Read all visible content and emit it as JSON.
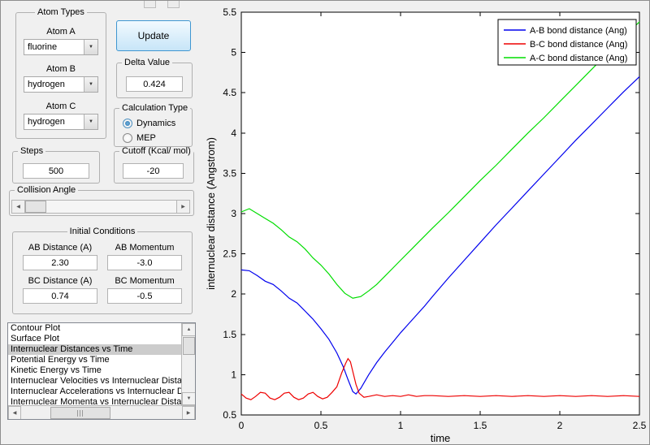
{
  "atom_types": {
    "title": "Atom Types",
    "atom_a_label": "Atom A",
    "atom_a_value": "fluorine",
    "atom_b_label": "Atom B",
    "atom_b_value": "hydrogen",
    "atom_c_label": "Atom C",
    "atom_c_value": "hydrogen"
  },
  "update_button_label": "Update",
  "delta": {
    "title": "Delta Value",
    "value": "0.424"
  },
  "calculation_type": {
    "title": "Calculation Type",
    "options": [
      "Dynamics",
      "MEP"
    ],
    "selected": "Dynamics"
  },
  "steps": {
    "title": "Steps",
    "value": "500"
  },
  "cutoff": {
    "title": "Cutoff (Kcal/ mol)",
    "value": "-20"
  },
  "collision_angle": {
    "title": "Collision Angle"
  },
  "initial_conditions": {
    "title": "Initial Conditions",
    "ab_distance_label": "AB Distance (A)",
    "ab_distance_value": "2.30",
    "ab_momentum_label": "AB Momentum",
    "ab_momentum_value": "-3.0",
    "bc_distance_label": "BC Distance (A)",
    "bc_distance_value": "0.74",
    "bc_momentum_label": "BC Momentum",
    "bc_momentum_value": "-0.5"
  },
  "plot_list": {
    "items": [
      "Contour Plot",
      "Surface Plot",
      "Internuclear Distances vs Time",
      "Potential Energy vs Time",
      "Kinetic Energy vs Time",
      "Internuclear Velocities vs Internuclear Distance",
      "Internuclear Accelerations vs Internuclear Distance",
      "Internuclear Momenta vs Internuclear Distance"
    ],
    "selected_index": 2
  },
  "chart_data": {
    "type": "line",
    "xlabel": "time",
    "ylabel": "internuclear distance (Angstrom)",
    "xlim": [
      0,
      2.5
    ],
    "ylim": [
      0.5,
      5.5
    ],
    "x_tick_values": [
      0,
      0.5,
      1,
      1.5,
      2,
      2.5
    ],
    "x_tick_labels": [
      "0",
      "0.5",
      "1",
      "1.5",
      "2",
      "2.5"
    ],
    "y_tick_values": [
      0.5,
      1,
      1.5,
      2,
      2.5,
      3,
      3.5,
      4,
      4.5,
      5,
      5.5
    ],
    "y_tick_labels": [
      "0.5",
      "1",
      "1.5",
      "2",
      "2.5",
      "3",
      "3.5",
      "4",
      "4.5",
      "5",
      "5.5"
    ],
    "grid": false,
    "legend": {
      "position": "northeast",
      "entries": [
        "A-B bond distance (Ang)",
        "B-C bond distance (Ang)",
        "A-C bond distance (Ang)"
      ]
    },
    "series": [
      {
        "name": "A-B bond distance (Ang)",
        "color": "#0000ee",
        "x": [
          0,
          0.05,
          0.1,
          0.15,
          0.2,
          0.25,
          0.3,
          0.35,
          0.4,
          0.45,
          0.5,
          0.55,
          0.6,
          0.64,
          0.67,
          0.7,
          0.72,
          0.75,
          0.8,
          0.85,
          0.9,
          0.95,
          1.0,
          1.05,
          1.1,
          1.15,
          1.2,
          1.3,
          1.4,
          1.5,
          1.6,
          1.7,
          1.8,
          1.9,
          2.0,
          2.1,
          2.2,
          2.3,
          2.4,
          2.5
        ],
        "y": [
          2.3,
          2.29,
          2.23,
          2.16,
          2.12,
          2.04,
          1.95,
          1.89,
          1.79,
          1.69,
          1.57,
          1.44,
          1.27,
          1.1,
          0.94,
          0.79,
          0.76,
          0.83,
          1.0,
          1.15,
          1.28,
          1.4,
          1.52,
          1.63,
          1.74,
          1.85,
          1.97,
          2.2,
          2.42,
          2.64,
          2.86,
          3.07,
          3.28,
          3.49,
          3.7,
          3.91,
          4.11,
          4.31,
          4.51,
          4.7
        ]
      },
      {
        "name": "B-C bond distance (Ang)",
        "color": "#ee0000",
        "x": [
          0,
          0.03,
          0.06,
          0.09,
          0.12,
          0.15,
          0.18,
          0.21,
          0.24,
          0.27,
          0.3,
          0.33,
          0.36,
          0.39,
          0.42,
          0.45,
          0.48,
          0.51,
          0.54,
          0.57,
          0.6,
          0.63,
          0.655,
          0.67,
          0.685,
          0.7,
          0.72,
          0.74,
          0.77,
          0.8,
          0.85,
          0.9,
          0.95,
          1.0,
          1.05,
          1.1,
          1.15,
          1.2,
          1.3,
          1.4,
          1.5,
          1.6,
          1.7,
          1.8,
          1.9,
          2.0,
          2.1,
          2.2,
          2.3,
          2.4,
          2.5
        ],
        "y": [
          0.76,
          0.71,
          0.69,
          0.73,
          0.78,
          0.77,
          0.71,
          0.69,
          0.72,
          0.77,
          0.78,
          0.72,
          0.69,
          0.71,
          0.76,
          0.78,
          0.73,
          0.7,
          0.72,
          0.78,
          0.85,
          1.02,
          1.14,
          1.2,
          1.16,
          1.04,
          0.88,
          0.77,
          0.72,
          0.73,
          0.75,
          0.73,
          0.74,
          0.73,
          0.75,
          0.73,
          0.74,
          0.74,
          0.73,
          0.74,
          0.73,
          0.74,
          0.73,
          0.74,
          0.73,
          0.74,
          0.73,
          0.74,
          0.73,
          0.74,
          0.73
        ]
      },
      {
        "name": "A-C bond distance (Ang)",
        "color": "#00dd00",
        "x": [
          0,
          0.05,
          0.1,
          0.15,
          0.2,
          0.25,
          0.3,
          0.35,
          0.4,
          0.45,
          0.5,
          0.55,
          0.6,
          0.65,
          0.7,
          0.75,
          0.8,
          0.85,
          0.9,
          0.95,
          1.0,
          1.1,
          1.2,
          1.3,
          1.4,
          1.5,
          1.6,
          1.7,
          1.8,
          1.9,
          2.0,
          2.1,
          2.2,
          2.3,
          2.4,
          2.5
        ],
        "y": [
          3.02,
          3.06,
          3.0,
          2.94,
          2.88,
          2.8,
          2.71,
          2.65,
          2.56,
          2.45,
          2.36,
          2.25,
          2.12,
          2.01,
          1.95,
          1.97,
          2.04,
          2.12,
          2.22,
          2.32,
          2.42,
          2.62,
          2.82,
          3.01,
          3.21,
          3.41,
          3.6,
          3.8,
          4.0,
          4.19,
          4.39,
          4.59,
          4.79,
          4.99,
          5.19,
          5.38
        ]
      }
    ]
  }
}
